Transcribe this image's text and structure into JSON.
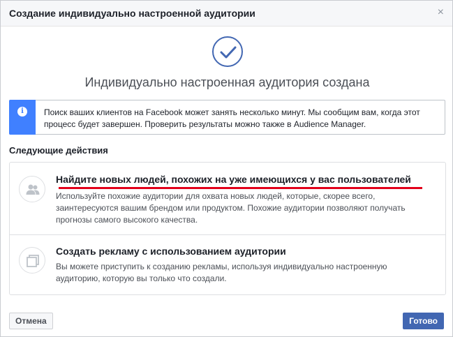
{
  "dialog": {
    "title": "Создание индивидуально настроенной аудитории",
    "close_symbol": "×"
  },
  "success": {
    "icon": "checkmark-circle-icon",
    "title": "Индивидуально настроенная аудитория создана"
  },
  "info": {
    "icon": "info-icon",
    "icon_symbol": "i",
    "text": "Поиск ваших клиентов на Facebook может занять несколько минут. Мы сообщим вам, когда этот процесс будет завершен. Проверить результаты можно также в Audience Manager."
  },
  "next_steps": {
    "heading": "Следующие действия",
    "items": [
      {
        "icon": "people-icon",
        "title": "Найдите новых людей, похожих на уже имеющихся у вас пользователей",
        "description": "Используйте похожие аудитории для охвата новых людей, которые, скорее всего, заинтересуются вашим брендом или продуктом. Похожие аудитории позволяют получать прогнозы самого высокого качества."
      },
      {
        "icon": "ad-copy-icon",
        "title": "Создать рекламу с использованием аудитории",
        "description": "Вы можете приступить к созданию рекламы, используя индивидуально настроенную аудиторию, которую вы только что создали."
      }
    ]
  },
  "footer": {
    "cancel_label": "Отмена",
    "done_label": "Готово"
  },
  "colors": {
    "accent": "#4267b2",
    "info_stripe": "#4080ff",
    "highlight_underline": "#e2001a"
  }
}
